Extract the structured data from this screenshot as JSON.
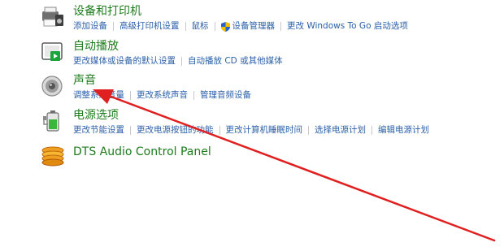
{
  "categories": [
    {
      "title": "设备和打印机",
      "icon": "printer-icon",
      "links": [
        "添加设备",
        "高级打印机设置",
        "鼠标",
        "设备管理器",
        "更改 Windows To Go 启动选项"
      ]
    },
    {
      "title": "自动播放",
      "icon": "autoplay-icon",
      "links": [
        "更改媒体或设备的默认设置",
        "自动播放 CD 或其他媒体"
      ]
    },
    {
      "title": "声音",
      "icon": "speaker-icon",
      "links": [
        "调整系统音量",
        "更改系统声音",
        "管理音频设备"
      ]
    },
    {
      "title": "电源选项",
      "icon": "battery-icon",
      "links": [
        "更改节能设置",
        "更改电源按钮的功能",
        "更改计算机睡眠时间",
        "选择电源计划",
        "编辑电源计划"
      ]
    },
    {
      "title": "DTS Audio Control Panel",
      "icon": "dts-audio-icon"
    }
  ],
  "annotation": {
    "arrow_color": "#e02020",
    "icon": "red-arrow-annotation"
  },
  "colors": {
    "category_title": "#1e7b1e",
    "link": "#2b5fa8",
    "shield_blue": "#2a62c9",
    "shield_yellow": "#f2c200"
  }
}
